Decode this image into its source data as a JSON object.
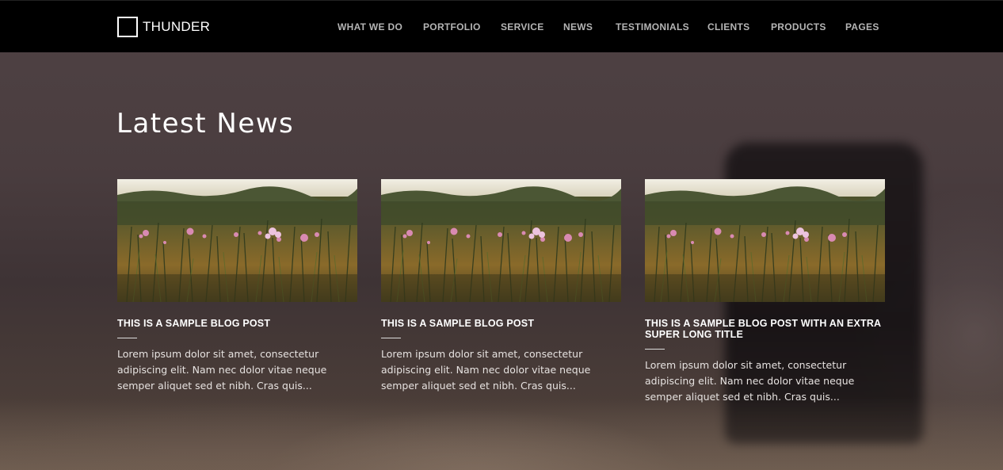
{
  "header": {
    "logo_text": "THUNDER",
    "nav": [
      {
        "label": "WHAT WE DO",
        "name": "nav-what-we-do"
      },
      {
        "label": "PORTFOLIO",
        "name": "nav-portfolio"
      },
      {
        "label": "SERVICE",
        "name": "nav-service"
      },
      {
        "label": "NEWS",
        "name": "nav-news"
      },
      {
        "label": "TESTIMONIALS",
        "name": "nav-testimonials"
      },
      {
        "label": "CLIENTS",
        "name": "nav-clients"
      },
      {
        "label": "PRODUCTS",
        "name": "nav-products"
      },
      {
        "label": "PAGES",
        "name": "nav-pages"
      }
    ]
  },
  "section": {
    "title": "Latest News"
  },
  "posts": [
    {
      "title": "THIS IS A SAMPLE BLOG POST",
      "excerpt": "Lorem ipsum dolor sit amet, consectetur adipiscing elit. Nam nec dolor vitae neque semper aliquet sed et nibh. Cras quis...",
      "image": "flower-field-photo"
    },
    {
      "title": "THIS IS A SAMPLE BLOG POST",
      "excerpt": "Lorem ipsum dolor sit amet, consectetur adipiscing elit. Nam nec dolor vitae neque semper aliquet sed et nibh. Cras quis...",
      "image": "flower-field-photo"
    },
    {
      "title": "THIS IS A SAMPLE BLOG POST WITH AN EXTRA SUPER LONG TITLE",
      "excerpt": "Lorem ipsum dolor sit amet, consectetur adipiscing elit. Nam nec dolor vitae neque semper aliquet sed et nibh. Cras quis...",
      "image": "flower-field-photo"
    }
  ],
  "colors": {
    "header_bg": "#000000",
    "nav_text": "#b5b5b5",
    "title_text": "#ffffff"
  }
}
